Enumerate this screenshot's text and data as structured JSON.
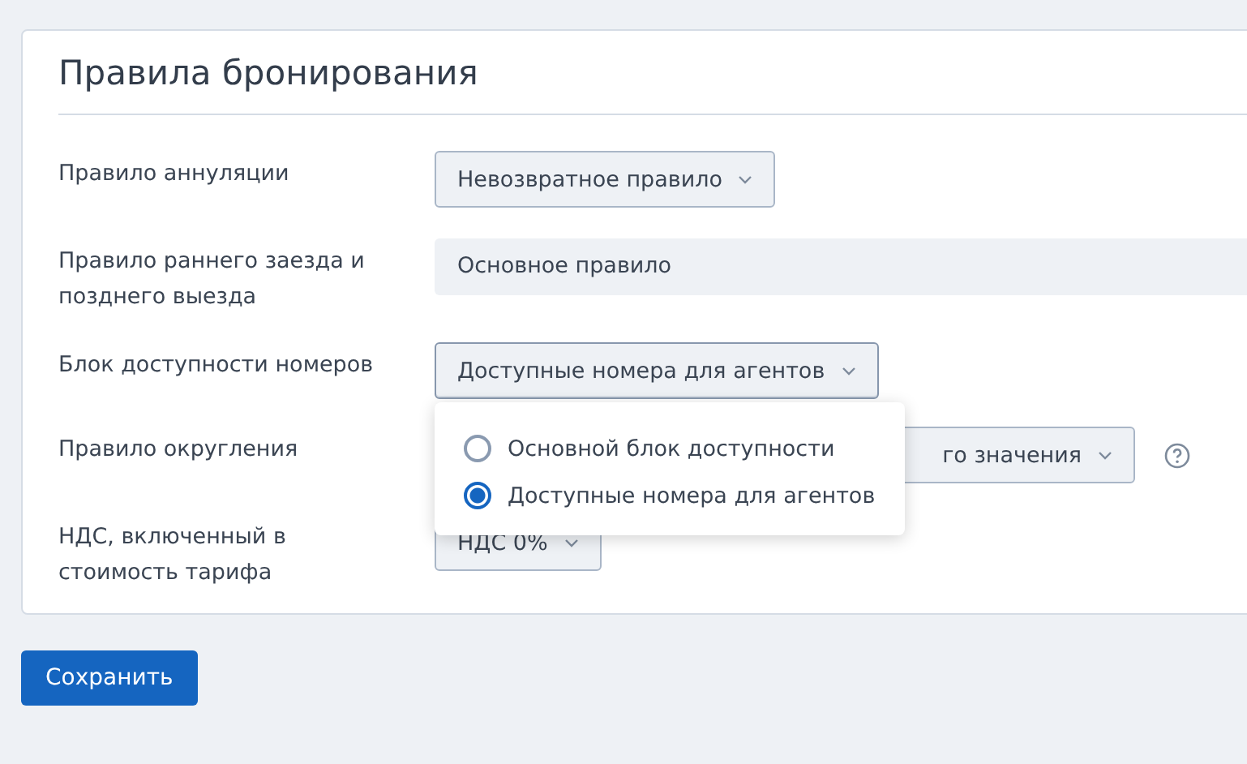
{
  "card": {
    "title": "Правила бронирования",
    "rows": [
      {
        "kind": "dropdown",
        "label": "Правило аннуляции",
        "value": "Невозвратное правило"
      },
      {
        "kind": "static",
        "label": "Правило раннего заезда и позднего выезда",
        "value": "Основное правило"
      },
      {
        "kind": "dropdown",
        "label": "Блок доступности номеров",
        "value": "Доступные номера для агентов",
        "expanded": true,
        "options": [
          {
            "label": "Основной блок доступности",
            "selected": false
          },
          {
            "label": "Доступные номера для агентов",
            "selected": true
          }
        ]
      },
      {
        "kind": "dropdown",
        "label": "Правило округления",
        "value": "го значения",
        "help": true
      },
      {
        "kind": "dropdown",
        "label": "НДС, включенный в стоимость тарифа",
        "value": "НДС 0%"
      }
    ]
  },
  "save_button": "Сохранить"
}
